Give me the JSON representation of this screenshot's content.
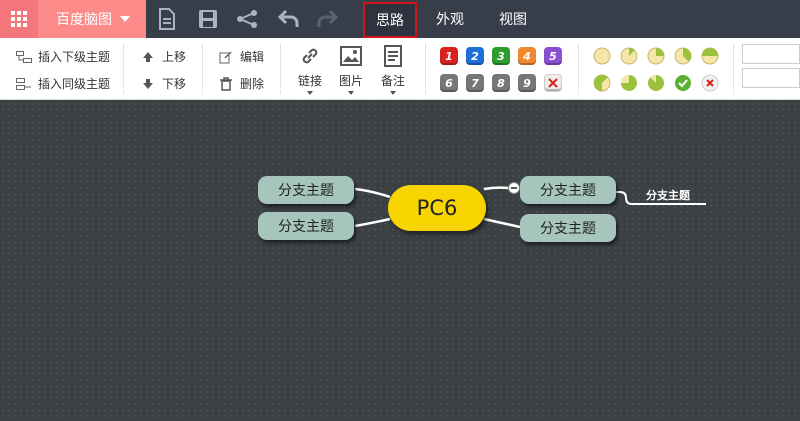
{
  "topbar": {
    "brand": "百度脑图",
    "tabs": [
      {
        "label": "思路",
        "active": true
      },
      {
        "label": "外观",
        "active": false
      },
      {
        "label": "视图",
        "active": false
      }
    ],
    "icons": [
      "new-document-icon",
      "save-icon",
      "share-icon",
      "undo-icon",
      "redo-icon"
    ]
  },
  "ribbon": {
    "insert_child": "插入下级主题",
    "insert_sibling": "插入同级主题",
    "move_up": "上移",
    "move_down": "下移",
    "edit": "编辑",
    "delete": "删除",
    "link": "链接",
    "image": "图片",
    "note": "备注",
    "priorities": [
      {
        "label": "1",
        "color": "#d9221f"
      },
      {
        "label": "2",
        "color": "#1e6fd9"
      },
      {
        "label": "3",
        "color": "#2d9d2d"
      },
      {
        "label": "4",
        "color": "#f0892e"
      },
      {
        "label": "5",
        "color": "#8a4fd2"
      },
      {
        "label": "6",
        "color": "#777777"
      },
      {
        "label": "7",
        "color": "#777777"
      },
      {
        "label": "8",
        "color": "#777777"
      },
      {
        "label": "9",
        "color": "#777777"
      }
    ],
    "remove_priority_icon": "close-icon",
    "progress_levels": [
      "0",
      "1/8",
      "2/8",
      "3/8",
      "4/8",
      "5/8",
      "6/8",
      "7/8",
      "done",
      "remove"
    ]
  },
  "mindmap": {
    "root": "PC6",
    "left_nodes": [
      "分支主题",
      "分支主题"
    ],
    "right_nodes": [
      "分支主题",
      "分支主题"
    ],
    "leaf": "分支主题",
    "colors": {
      "root": "#f8d400",
      "node": "#a6c6bd",
      "canvas": "#3b4043",
      "active_tab_border": "#d0141b"
    }
  }
}
